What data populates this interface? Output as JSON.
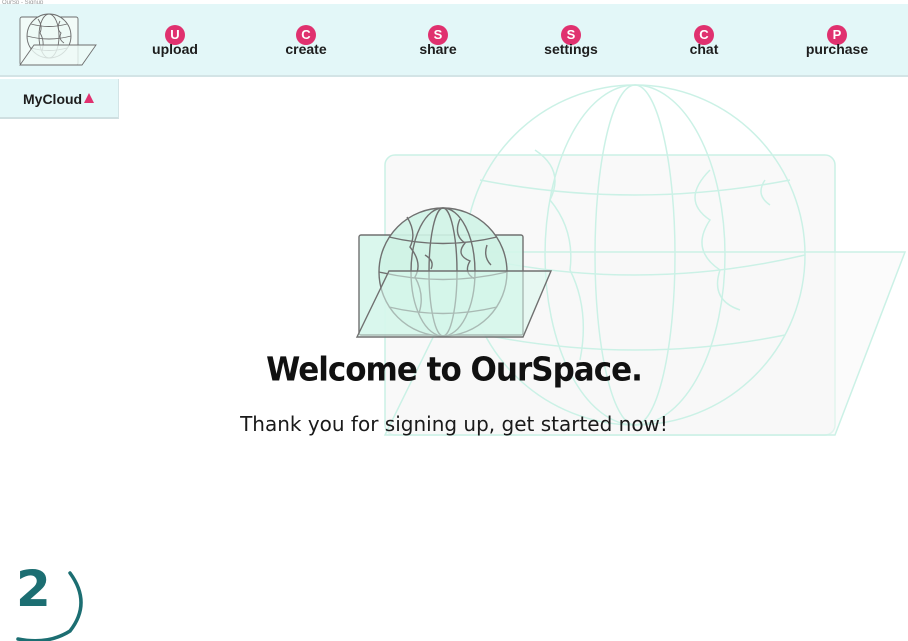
{
  "window": {
    "caption": "OurSp - Signup"
  },
  "nav": {
    "items": [
      {
        "badge": "U",
        "label": "upload"
      },
      {
        "badge": "C",
        "label": "create"
      },
      {
        "badge": "S",
        "label": "share"
      },
      {
        "badge": "S",
        "label": "settings"
      },
      {
        "badge": "C",
        "label": "chat"
      },
      {
        "badge": "P",
        "label": "purchase"
      }
    ]
  },
  "menu": {
    "mycloud_label": "MyCloud"
  },
  "main": {
    "headline": "Welcome to OurSpace.",
    "subline": "Thank you for signing up, get started now!"
  },
  "step": {
    "number": "2"
  },
  "colors": {
    "accent": "#e0316f",
    "header_bg": "#e3f7f8",
    "step": "#1c6e72",
    "globe_fill": "#d4f6ea"
  },
  "icons": {
    "logo": "globe-folder-icon",
    "caret": "caret-up-icon"
  }
}
